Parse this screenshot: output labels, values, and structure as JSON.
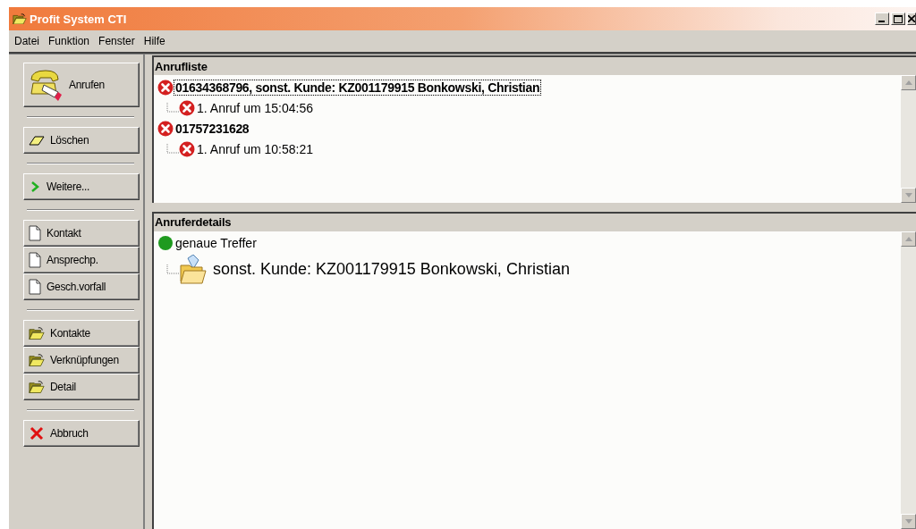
{
  "window": {
    "title": "Profit System CTI"
  },
  "menu": [
    "Datei",
    "Funktion",
    "Fenster",
    "Hilfe"
  ],
  "sidebar": {
    "groups": [
      [
        {
          "label": "Anrufen",
          "kind": "phone"
        }
      ],
      [
        {
          "label": "Löschen",
          "kind": "eraser"
        }
      ],
      [
        {
          "label": "Weitere...",
          "kind": "arrow"
        }
      ],
      [
        {
          "label": "Kontakt",
          "kind": "document"
        },
        {
          "label": "Ansprechp.",
          "kind": "document"
        },
        {
          "label": "Gesch.vorfall",
          "kind": "document"
        }
      ],
      [
        {
          "label": "Kontakte",
          "kind": "folder"
        },
        {
          "label": "Verknüpfungen",
          "kind": "folder"
        },
        {
          "label": "Detail",
          "kind": "folder"
        }
      ],
      [
        {
          "label": "Abbruch",
          "kind": "cross"
        }
      ]
    ]
  },
  "call_list": {
    "title": "Anrufliste",
    "items": [
      {
        "label": "01634368796,  sonst. Kunde: KZ001179915 Bonkowski, Christian",
        "selected": true,
        "children": [
          {
            "label": "1. Anruf um 15:04:56"
          }
        ]
      },
      {
        "label": "01757231628",
        "selected": false,
        "children": [
          {
            "label": "1. Anruf um 10:58:21"
          }
        ]
      }
    ]
  },
  "caller_details": {
    "title": "Anruferdetails",
    "items": [
      {
        "label": "genaue Treffer",
        "color": "#1f9a1f",
        "children": [
          {
            "label": "sonst. Kunde: KZ001179915 Bonkowski, Christian"
          }
        ]
      }
    ]
  }
}
